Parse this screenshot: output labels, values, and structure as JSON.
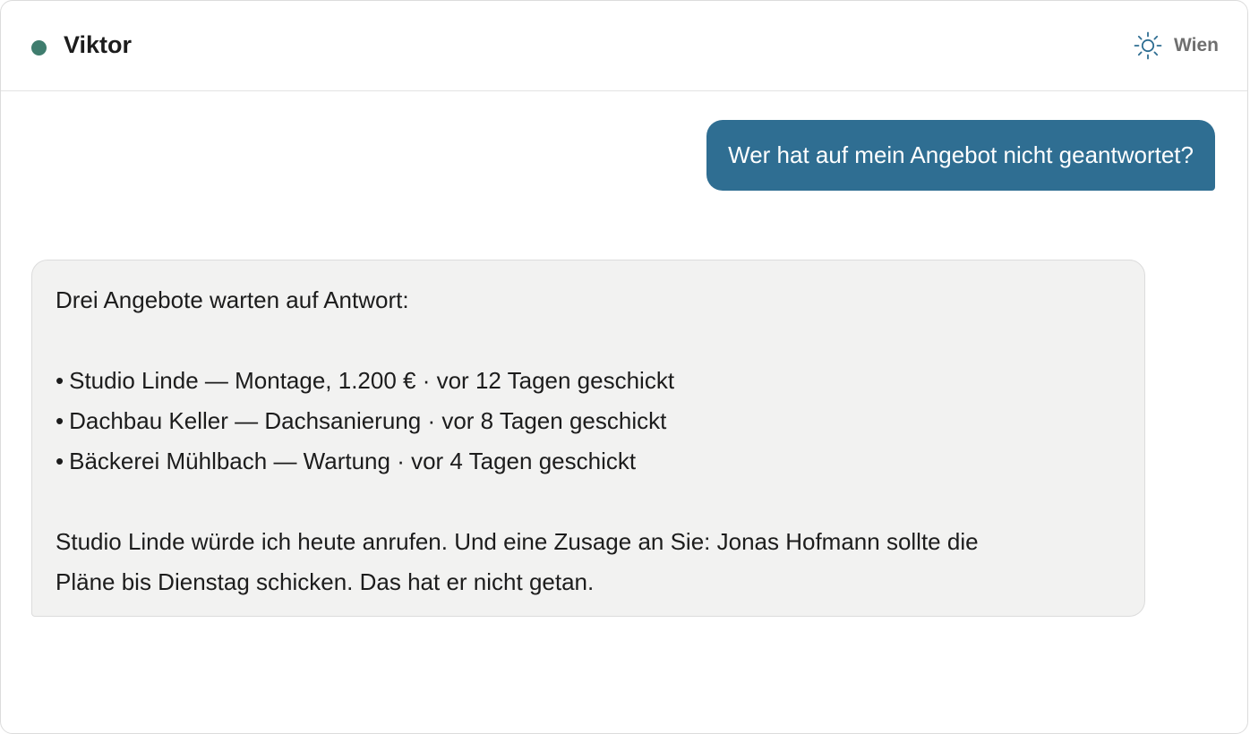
{
  "header": {
    "assistant_name": "Viktor",
    "status_color": "#3f7d6e",
    "weather_icon": "sun-icon",
    "weather_city": "Wien"
  },
  "conversation": {
    "user_message": "Wer hat auf mein Angebot nicht geantwortet?",
    "assistant_message": {
      "intro": "Drei Angebote warten auf Antwort:",
      "items": [
        "Studio Linde — Montage, 1.200 € · vor 12 Tagen geschickt",
        "Dachbau Keller — Dachsanierung · vor 8 Tagen geschickt",
        "Bäckerei Mühlbach — Wartung · vor 4 Tagen geschickt"
      ],
      "closing_line_1": "Studio Linde würde ich heute anrufen. Und eine Zusage an Sie: Jonas Hofmann sollte die",
      "closing_line_2": "Pläne bis Dienstag schicken. Das hat er nicht getan."
    }
  },
  "colors": {
    "user_bubble": "#2f6e92",
    "assistant_bubble": "#f2f2f1",
    "accent": "#3f7d6e"
  }
}
